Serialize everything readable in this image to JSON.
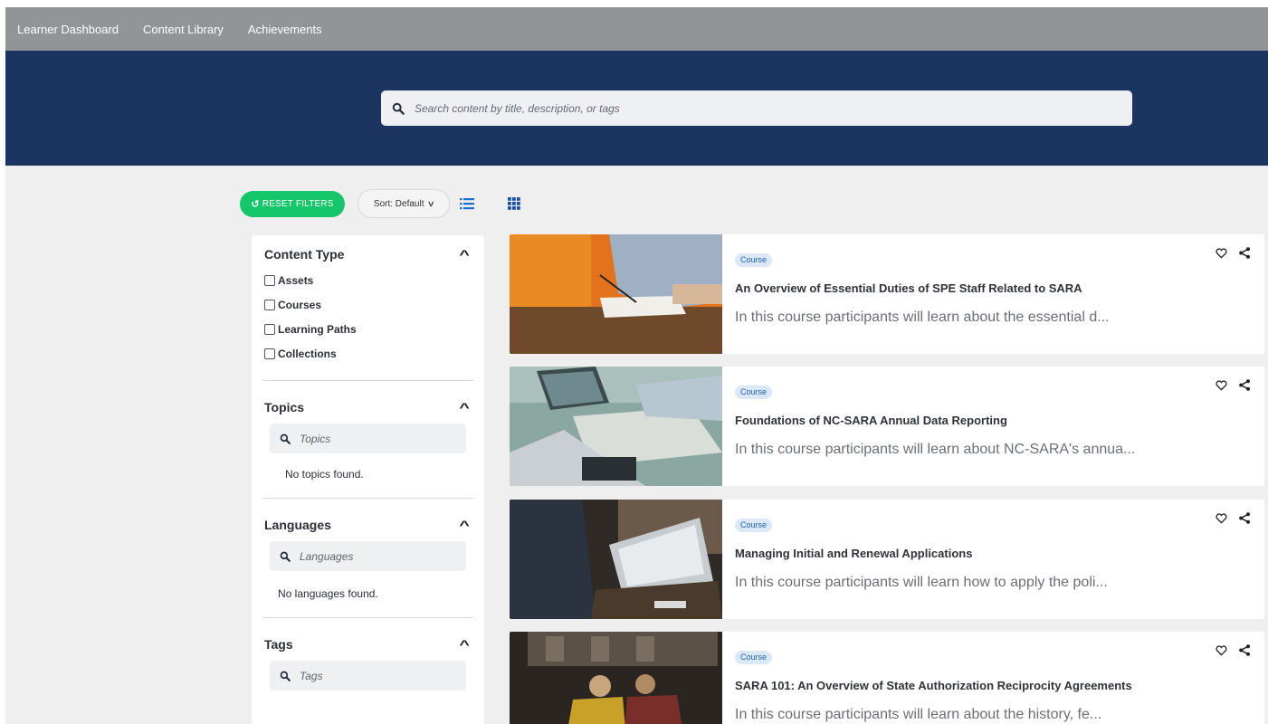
{
  "nav": {
    "items": [
      "Learner Dashboard",
      "Content Library",
      "Achievements"
    ]
  },
  "search": {
    "placeholder": "Search content by title, description, or tags",
    "icon": "search-icon"
  },
  "toolbar": {
    "reset_label": "RESET FILTERS",
    "sort_label": "Sort: Default",
    "list_view_icon": "list-view-icon",
    "grid_view_icon": "grid-view-icon"
  },
  "filters": {
    "content_type": {
      "title": "Content Type",
      "options": [
        "Assets",
        "Courses",
        "Learning Paths",
        "Collections"
      ]
    },
    "topics": {
      "title": "Topics",
      "placeholder": "Topics",
      "empty": "No topics found."
    },
    "languages": {
      "title": "Languages",
      "placeholder": "Languages",
      "empty": "No languages found."
    },
    "tags": {
      "title": "Tags",
      "placeholder": "Tags"
    }
  },
  "cards": [
    {
      "badge": "Course",
      "title": "An Overview of Essential Duties of SPE Staff Related to SARA",
      "description": "In this course participants will learn about the essential d..."
    },
    {
      "badge": "Course",
      "title": "Foundations of NC-SARA Annual Data Reporting",
      "description": "In this course participants will learn about NC-SARA's annua..."
    },
    {
      "badge": "Course",
      "title": "Managing Initial and Renewal Applications",
      "description": "In this course participants will learn how to apply the poli..."
    },
    {
      "badge": "Course",
      "title": "SARA 101: An Overview of State Authorization Reciprocity Agreements",
      "description": "In this course participants will learn about the history, fe..."
    }
  ],
  "colors": {
    "nav_bg": "#929497",
    "hero_bg": "#1c3560",
    "accent_green": "#15c76a",
    "badge_text": "#1f5fb5"
  }
}
